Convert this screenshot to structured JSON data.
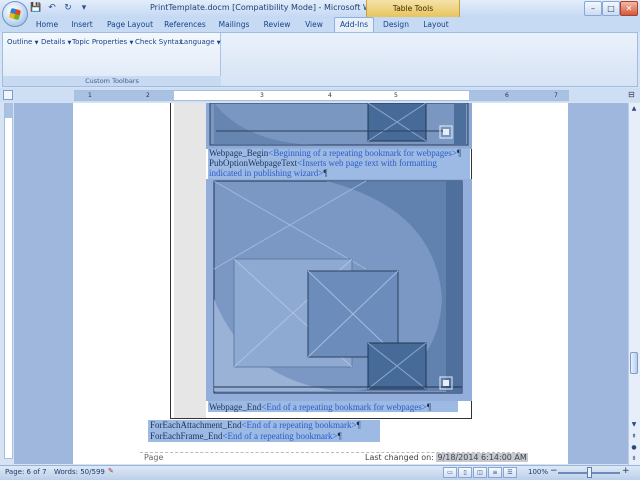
{
  "window": {
    "title": "PrintTemplate.docm [Compatibility Mode] - Microsoft Word",
    "context_tools": "Table Tools",
    "controls": {
      "minimize": "–",
      "maximize": "□",
      "close": "✕"
    }
  },
  "quick_access": {
    "save": "💾",
    "undo": "↶",
    "redo": "↻",
    "customize": "▾"
  },
  "tabs": [
    "Home",
    "Insert",
    "Page Layout",
    "References",
    "Mailings",
    "Review",
    "View",
    "Add-Ins",
    "Design",
    "Layout"
  ],
  "active_tab": "Add-Ins",
  "ribbon": {
    "buttons": [
      "Outline",
      "Details",
      "Topic Properties",
      "Check Syntax",
      "Language"
    ],
    "group_label": "Custom Toolbars"
  },
  "ruler": {
    "marks": [
      "1",
      "2",
      "3",
      "4",
      "5",
      "6",
      "7"
    ]
  },
  "document": {
    "webpage_begin_field": "Webpage_Begin",
    "webpage_begin_note": "<Beginning of a repeating bookmark for webpages>",
    "pub_option_field": "PubOptionWebpageText",
    "pub_option_note_line1": "<Inserts web page text with formatting",
    "pub_option_note_line2": "indicated in publishing wizard>",
    "webpage_end_field": "Webpage_End",
    "webpage_end_note": "<End of a repeating bookmark for webpages>",
    "attachment_end_field": "ForEachAttachment_End",
    "attachment_end_note": "<End of a repeating bookmark>",
    "frame_end_field": "ForEachFrame_End",
    "frame_end_note": "<End of a repeating bookmark>",
    "para_mark": "¶"
  },
  "footer": {
    "page_label": "Page",
    "last_changed_label": "Last changed on:",
    "last_changed_value": "9/18/2014 6:14:00 AM"
  },
  "status": {
    "page": "Page: 6 of 7",
    "words": "Words: 50/599",
    "zoom": "100%",
    "zoom_minus": "−",
    "zoom_plus": "+"
  },
  "colors": {
    "accent": "#15428b",
    "selection": "#91b2e1",
    "image_frame": "#5d80ad"
  }
}
